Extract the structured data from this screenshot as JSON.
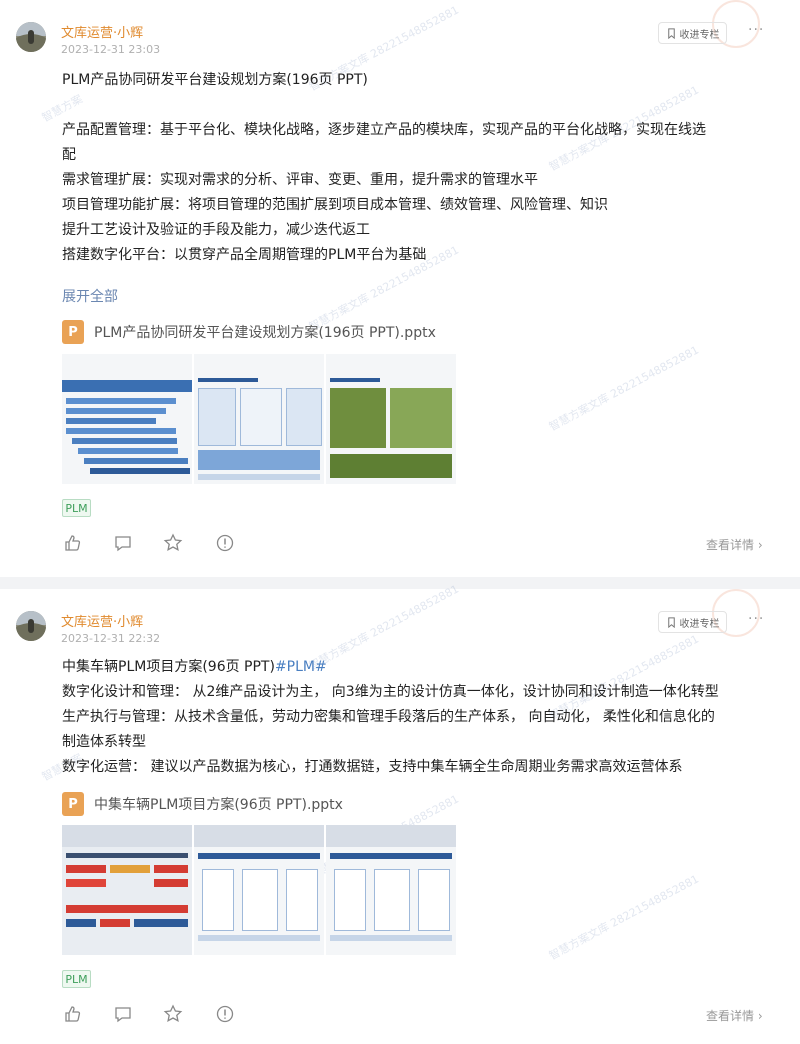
{
  "posts": [
    {
      "author": "文库运营·小辉",
      "time": "2023-12-31 23:03",
      "favorite_label": "收进专栏",
      "title": "PLM产品协同研发平台建设规划方案(196页 PPT)",
      "lines": [
        "产品配置管理：基于平台化、模块化战略，逐步建立产品的模块库，实现产品的平台化战略，实现在线选",
        "配",
        "需求管理扩展：实现对需求的分析、评审、变更、重用，提升需求的管理水平",
        "项目管理功能扩展：将项目管理的范围扩展到项目成本管理、绩效管理、风险管理、知识",
        "提升工艺设计及验证的手段及能力，减少迭代返工",
        "搭建数字化平台：以贯穿产品全周期管理的PLM平台为基础"
      ],
      "expand_label": "展开全部",
      "file_icon": "P",
      "file_name": "PLM产品协同研发平台建设规划方案(196页 PPT).pptx",
      "tag": "PLM",
      "detail_label": "查看详情"
    },
    {
      "author": "文库运营·小辉",
      "time": "2023-12-31 22:32",
      "favorite_label": "收进专栏",
      "title": "中集车辆PLM项目方案(96页 PPT)",
      "title_hashtag": "#PLM#",
      "lines": [
        "数字化设计和管理：  从2维产品设计为主， 向3维为主的设计仿真一体化，设计协同和设计制造一体化转型",
        "生产执行与管理：从技术含量低，劳动力密集和管理手段落后的生产体系，  向自动化，  柔性化和信息化的",
        "制造体系转型",
        "数字化运营：  建议以产品数据为核心，打通数据链，支持中集车辆全生命周期业务需求高效运营体系"
      ],
      "file_icon": "P",
      "file_name": "中集车辆PLM项目方案(96页 PPT).pptx",
      "tag": "PLM",
      "detail_label": "查看详情"
    }
  ],
  "icons": [
    "like-icon",
    "comment-icon",
    "star-icon",
    "report-icon",
    "more-icon",
    "bookmark-icon"
  ],
  "colors": {
    "author": "#e08a2e",
    "link": "#6b87b1",
    "tag_text": "#3d9e5a",
    "ppt_icon": "#e9a255"
  }
}
